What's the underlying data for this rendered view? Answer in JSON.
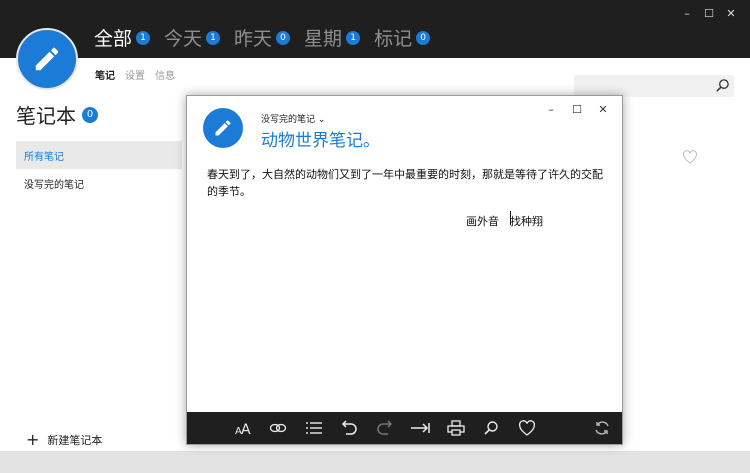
{
  "header": {
    "filters": [
      {
        "label": "全部",
        "count": "1",
        "active": true
      },
      {
        "label": "今天",
        "count": "1"
      },
      {
        "label": "昨天",
        "count": "0"
      },
      {
        "label": "星期",
        "count": "1"
      },
      {
        "label": "标记",
        "count": "0"
      }
    ],
    "subnav": [
      "笔记",
      "设置",
      "信息"
    ],
    "window_controls": [
      "–",
      "☐",
      "✕"
    ],
    "accent": "#1b7bd6"
  },
  "sidebar": {
    "title": "笔记本",
    "count": "0",
    "items": [
      {
        "label": "所有笔记",
        "active": true
      },
      {
        "label": "没写完的笔记"
      }
    ],
    "new_notebook": "新建笔记本"
  },
  "note_window": {
    "notebook": "没写完的笔记",
    "title": "动物世界笔记。",
    "body": "春天到了，大自然的动物们又到了一年中最重要的时刻，那就是等待了许久的交配的季节。",
    "ime_left": "画外音",
    "ime_right": "找种翔",
    "controls": [
      "–",
      "☐",
      "✕"
    ],
    "toolbar": [
      "font-size-icon",
      "link-icon",
      "list-icon",
      "undo-icon",
      "redo-icon",
      "indent-icon",
      "print-icon",
      "search-icon",
      "heart-icon",
      "sync-icon"
    ]
  }
}
